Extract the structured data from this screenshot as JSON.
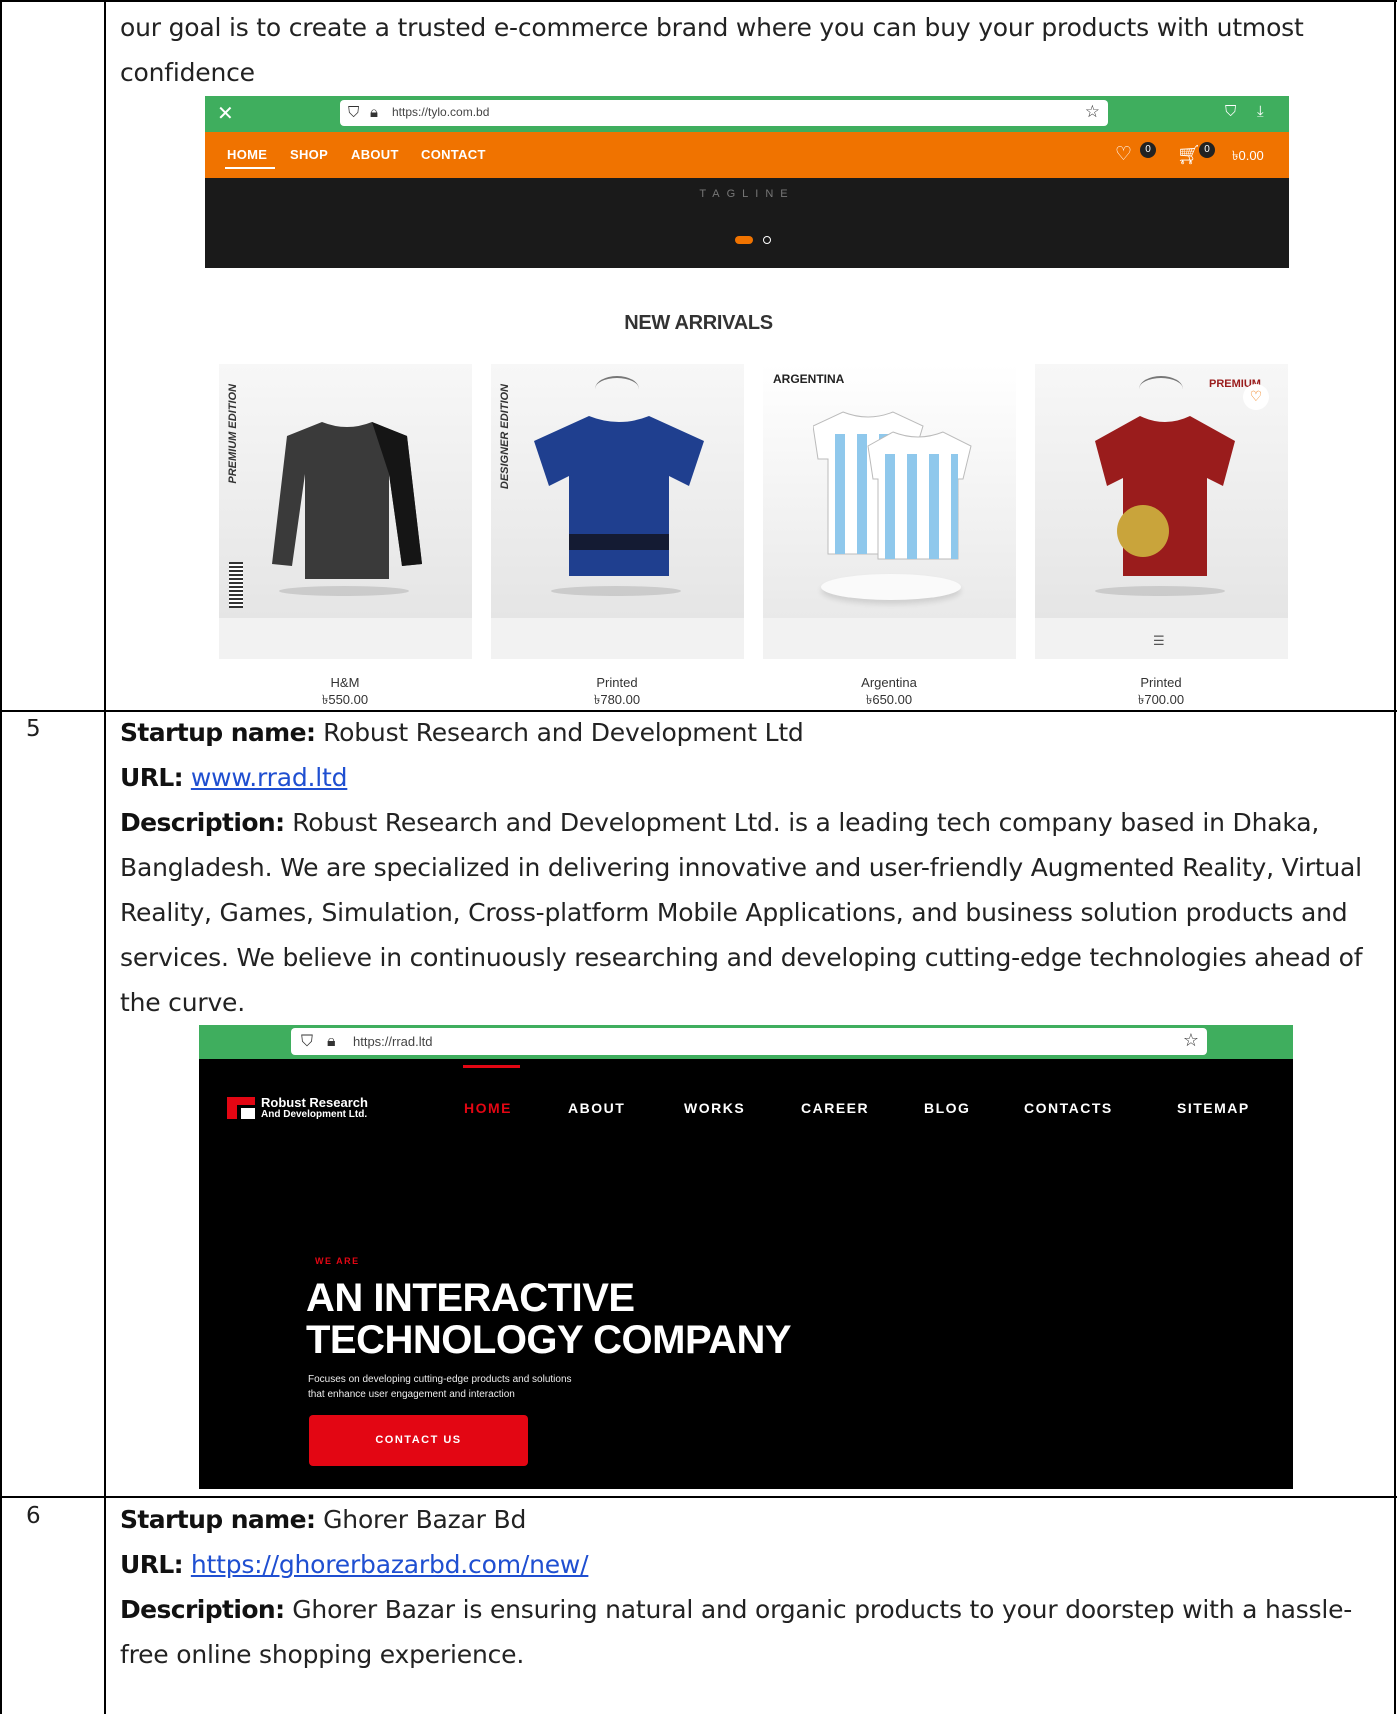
{
  "rows": [
    {
      "number": "",
      "intro": "our goal is to create a trusted e-commerce brand where you can buy your products with utmost confidence",
      "screenshot": {
        "url": "https://tylo.com.bd",
        "nav": [
          "HOME",
          "SHOP",
          "ABOUT",
          "CONTACT"
        ],
        "wishlist_count": "0",
        "cart_count": "0",
        "cart_total": "৳0.00",
        "tagline": "TAGLINE",
        "section_title": "NEW ARRIVALS",
        "products": [
          {
            "name": "H&M",
            "price": "৳550.00",
            "side_text": "PREMIUM EDITION",
            "color": "#3a3a3a"
          },
          {
            "name": "Printed",
            "price": "৳780.00",
            "side_text": "DESIGNER EDITION",
            "color": "#1f3f8f"
          },
          {
            "name": "Argentina",
            "price": "৳650.00",
            "side_text": "ARGENTINA",
            "color": "#8fc8ec"
          },
          {
            "name": "Printed",
            "price": "৳700.00",
            "side_text": "PREMIUM",
            "color": "#9a1c1c"
          }
        ]
      }
    },
    {
      "number": "5",
      "name_label": "Startup name:",
      "name": " Robust Research and Development Ltd",
      "url_label": "URL:",
      "url": "www.rrad.ltd",
      "desc_label": "Description:",
      "description": " Robust Research and Development Ltd. is a leading tech company based in Dhaka, Bangladesh. We are specialized in delivering innovative and user-friendly Augmented Reality, Virtual Reality, Games, Simulation, Cross-platform Mobile Applications, and business solution products and services. We believe in continuously researching and developing cutting-edge technologies ahead of the curve.",
      "screenshot": {
        "url": "https://rrad.ltd",
        "logo_line1": "Robust Research",
        "logo_line2": "And Development Ltd.",
        "nav": [
          "HOME",
          "ABOUT",
          "WORKS",
          "CAREER",
          "BLOG",
          "CONTACTS",
          "SITEMAP"
        ],
        "eyebrow": "WE ARE",
        "headline_1": "AN INTERACTIVE",
        "headline_2": "TECHNOLOGY COMPANY",
        "sub_1": "Focuses on developing cutting-edge products and solutions",
        "sub_2": "that enhance user engagement and interaction",
        "cta": "CONTACT US"
      }
    },
    {
      "number": "6",
      "name_label": "Startup name:",
      "name": " Ghorer Bazar Bd",
      "url_label": "URL:",
      "url": "https://ghorerbazarbd.com/new/",
      "desc_label": "Description:",
      "description": " Ghorer Bazar is ensuring natural and organic products to your doorstep with a hassle-free online shopping experience."
    }
  ],
  "colors": {
    "tylo_orange": "#f07300",
    "browser_green": "#3fae5e",
    "rrad_red": "#e30613",
    "link_blue": "#1f4fd1"
  },
  "icons": [
    "close-icon",
    "shield-icon",
    "lock-icon",
    "star-icon",
    "heart-icon",
    "cart-icon",
    "download-icon",
    "pocket-icon"
  ]
}
